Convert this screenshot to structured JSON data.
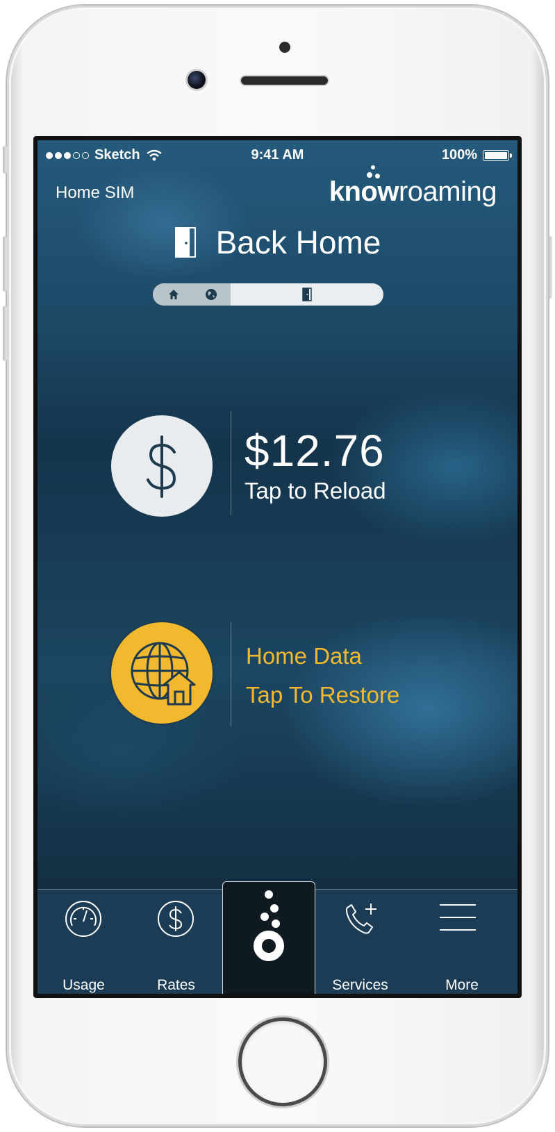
{
  "status_bar": {
    "carrier": "Sketch",
    "time": "9:41 AM",
    "battery": "100%"
  },
  "header": {
    "sim_label": "Home SIM",
    "logo_bold": "know",
    "logo_light": "roaming"
  },
  "page": {
    "title": "Back Home"
  },
  "mode_switch": {
    "items": [
      "home-icon",
      "globe-icon",
      "door-icon"
    ],
    "selected": "door-icon"
  },
  "balance": {
    "amount": "$12.76",
    "action": "Tap to Reload"
  },
  "home_data": {
    "title": "Home Data",
    "action": "Tap To Restore"
  },
  "tab_bar": {
    "items": [
      {
        "label": "Usage",
        "icon": "gauge-icon"
      },
      {
        "label": "Rates",
        "icon": "dollar-icon"
      },
      {
        "label": "",
        "icon": "knowroaming-logo-icon"
      },
      {
        "label": "Services",
        "icon": "phone-plus-icon"
      },
      {
        "label": "More",
        "icon": "menu-icon"
      }
    ]
  },
  "colors": {
    "accent": "#f2b92e",
    "tab_bar": "#1b3c54",
    "background": "#1d4866"
  }
}
